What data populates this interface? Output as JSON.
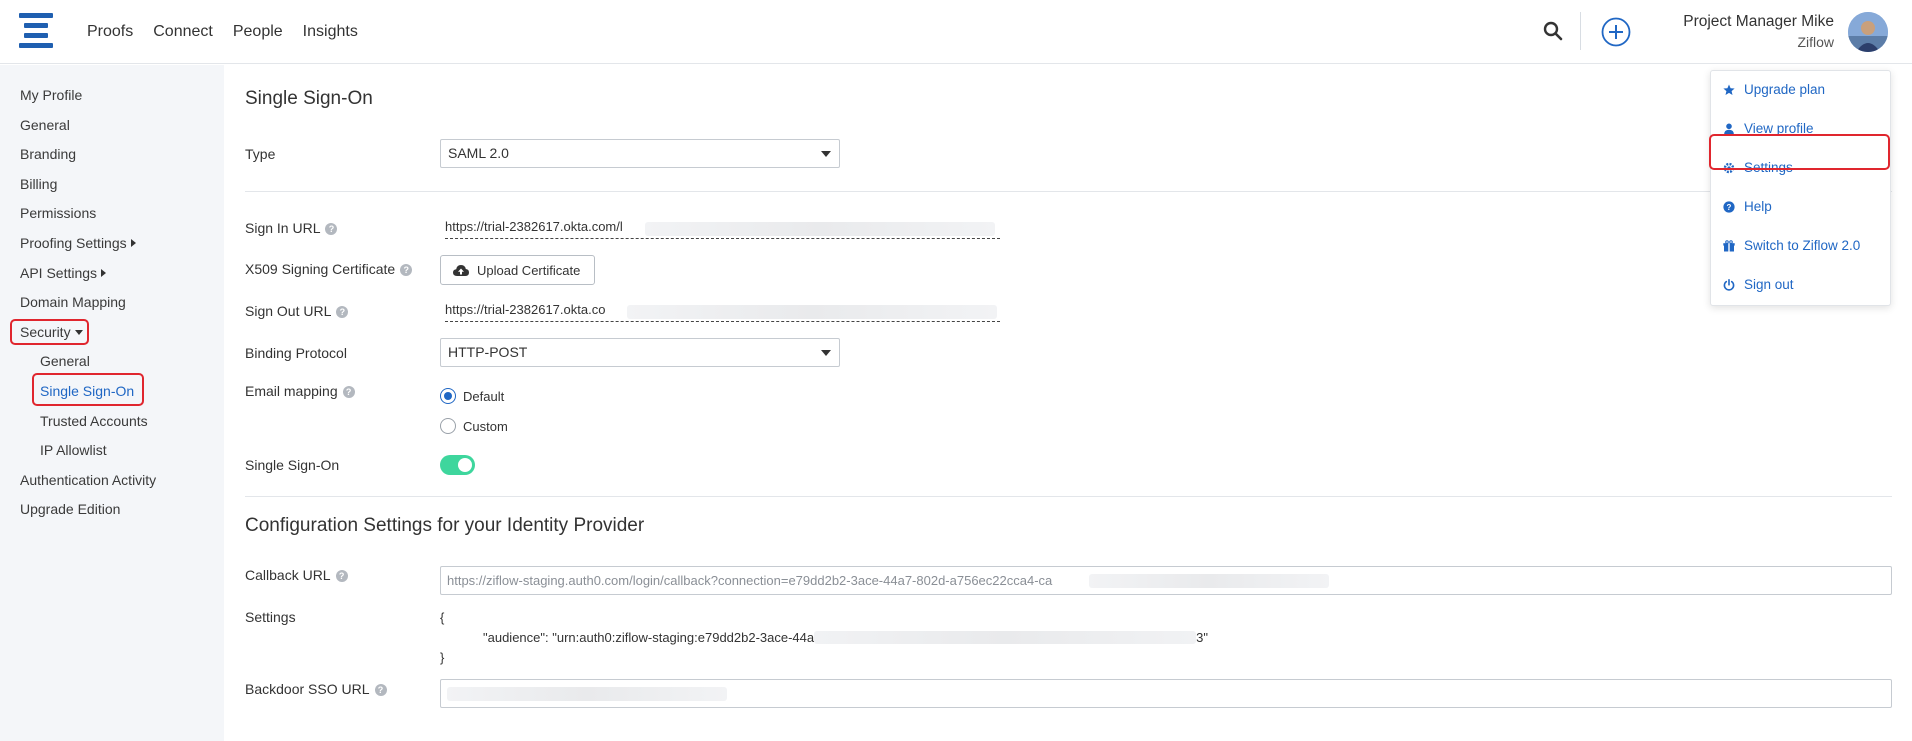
{
  "nav": {
    "links": [
      "Proofs",
      "Connect",
      "People",
      "Insights"
    ],
    "user_name": "Project Manager Mike",
    "user_org": "Ziflow"
  },
  "sidebar": {
    "items": [
      {
        "label": "My Profile"
      },
      {
        "label": "General"
      },
      {
        "label": "Branding"
      },
      {
        "label": "Billing"
      },
      {
        "label": "Permissions"
      },
      {
        "label": "Proofing Settings"
      },
      {
        "label": "API Settings"
      },
      {
        "label": "Domain Mapping"
      },
      {
        "label": "Security"
      },
      {
        "label": "General"
      },
      {
        "label": "Single Sign-On"
      },
      {
        "label": "Trusted Accounts"
      },
      {
        "label": "IP Allowlist"
      },
      {
        "label": "Authentication Activity"
      },
      {
        "label": "Upgrade Edition"
      }
    ]
  },
  "sso": {
    "title": "Single Sign-On",
    "type_label": "Type",
    "type_value": "SAML 2.0",
    "sign_in_label": "Sign In URL",
    "sign_in_value": "https://trial-2382617.okta.com/l",
    "cert_label": "X509 Signing Certificate",
    "upload_label": "Upload Certificate",
    "sign_out_label": "Sign Out URL",
    "sign_out_value": "https://trial-2382617.okta.co",
    "binding_label": "Binding Protocol",
    "binding_value": "HTTP-POST",
    "email_label": "Email mapping",
    "email_options": [
      "Default",
      "Custom"
    ],
    "email_selected": "Default",
    "toggle_label": "Single Sign-On",
    "enabled": true
  },
  "config": {
    "title": "Configuration Settings for your Identity Provider",
    "callback_label": "Callback URL",
    "callback_value": "https://ziflow-staging.auth0.com/login/callback?connection=e79dd2b2-3ace-44a7-802d-a756ec22cca4-ca",
    "settings_label": "Settings",
    "settings_open": "{",
    "settings_line": "\"audience\": \"urn:auth0:ziflow-staging:e79dd2b2-3ace-44a",
    "settings_tail": "3\"",
    "settings_close": "}",
    "backdoor_label": "Backdoor SSO URL"
  },
  "menu": {
    "items": [
      {
        "label": "Upgrade plan",
        "icon": "star-icon"
      },
      {
        "label": "View profile",
        "icon": "user-icon"
      },
      {
        "label": "Settings",
        "icon": "gear-icon"
      },
      {
        "label": "Help",
        "icon": "question-icon"
      },
      {
        "label": "Switch to Ziflow 2.0",
        "icon": "gift-icon"
      },
      {
        "label": "Sign out",
        "icon": "power-icon"
      }
    ]
  },
  "colors": {
    "accent": "#2067c4",
    "highlight": "#e0262e",
    "toggle_on": "#3ed69d",
    "sidebar_bg": "#f4f6f9"
  }
}
